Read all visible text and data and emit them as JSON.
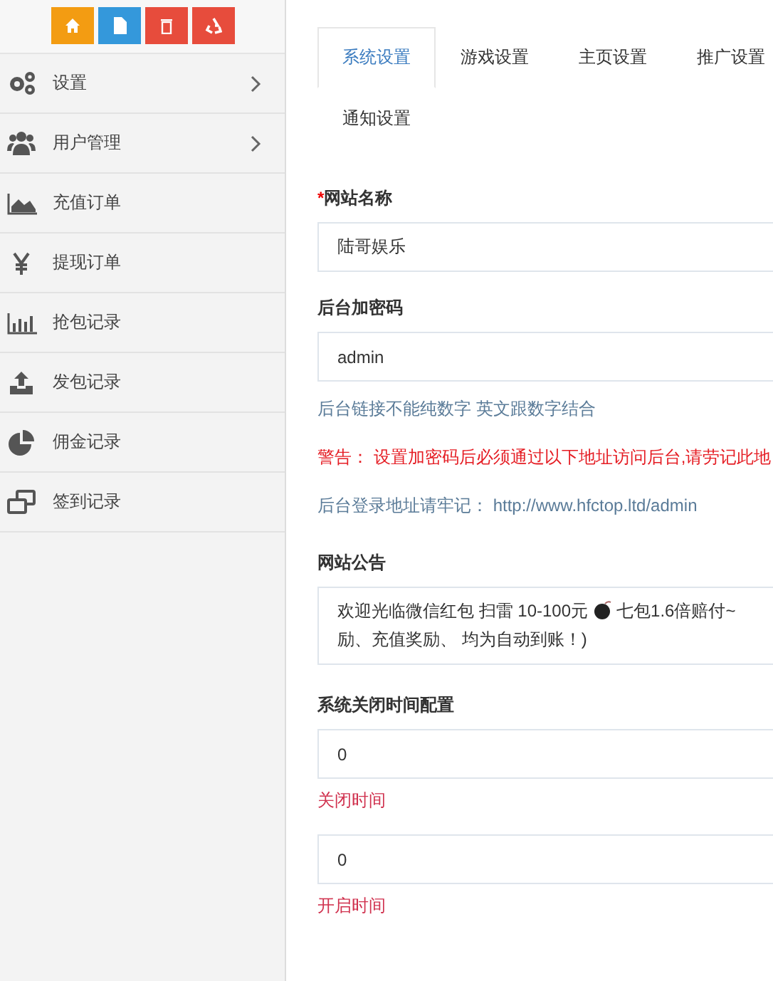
{
  "toolbar": [
    {
      "kind": "home",
      "color": "#f39c12"
    },
    {
      "kind": "file",
      "color": "#3498db"
    },
    {
      "kind": "trash",
      "color": "#e74c3c"
    },
    {
      "kind": "recycle",
      "color": "#e74c3c"
    }
  ],
  "sidebar": {
    "items": [
      {
        "label": "设置",
        "expandable": true
      },
      {
        "label": "用户管理",
        "expandable": true
      },
      {
        "label": "充值订单",
        "expandable": false
      },
      {
        "label": "提现订单",
        "expandable": false
      },
      {
        "label": "抢包记录",
        "expandable": false
      },
      {
        "label": "发包记录",
        "expandable": false
      },
      {
        "label": "佣金记录",
        "expandable": false
      },
      {
        "label": "签到记录",
        "expandable": false
      }
    ]
  },
  "tabs": [
    {
      "label": "系统设置",
      "selected": true
    },
    {
      "label": "游戏设置",
      "selected": false
    },
    {
      "label": "主页设置",
      "selected": false
    },
    {
      "label": "推广设置",
      "selected": false
    },
    {
      "label": "通知设置",
      "selected": false
    }
  ],
  "form": [
    {
      "kind": "input",
      "label": "网站名称",
      "required_mark": "*",
      "value": "陆哥娱乐"
    },
    {
      "kind": "input",
      "label": "后台加密码",
      "value": "admin"
    },
    {
      "kind": "help",
      "text": "后台链接不能纯数字 英文跟数字结合"
    },
    {
      "kind": "warning",
      "text": "警告： 设置加密码后必须通过以下地址访问后台,请劳记此地"
    },
    {
      "kind": "help",
      "text": "后台登录地址请牢记： http://www.hfctop.ltd/admin"
    },
    {
      "kind": "notice",
      "label": "网站公告",
      "before_icon": "欢迎光临微信红包 扫雷  10-100元",
      "after_icon": "七包1.6倍赔付~",
      "line_2": "励、充值奖励、 均为自动到账！)"
    },
    {
      "kind": "heading",
      "label": "系统关闭时间配置"
    },
    {
      "kind": "input",
      "value": "0"
    },
    {
      "kind": "note",
      "text": "关闭时间"
    },
    {
      "kind": "input",
      "value": "0"
    },
    {
      "kind": "note",
      "text": "开启时间"
    }
  ]
}
